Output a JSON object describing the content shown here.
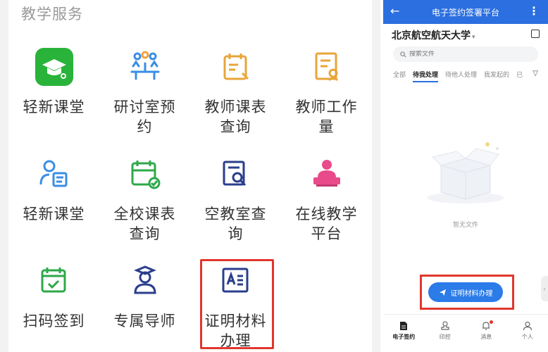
{
  "left": {
    "section_title": "教学服务",
    "tiles": [
      {
        "label": "轻新课堂",
        "icon": "graduation-cap-app-icon"
      },
      {
        "label": "研讨室预约",
        "icon": "meeting-people-icon"
      },
      {
        "label": "教师课表查询",
        "icon": "calendar-icon"
      },
      {
        "label": "教师工作量",
        "icon": "document-person-icon"
      },
      {
        "label": "轻新课堂",
        "icon": "person-card-icon"
      },
      {
        "label": "全校课表查询",
        "icon": "calendar-check-icon"
      },
      {
        "label": "空教室查询",
        "icon": "room-search-icon"
      },
      {
        "label": "在线教学平台",
        "icon": "online-teacher-icon"
      },
      {
        "label": "扫码签到",
        "icon": "calendar-checkmark-icon"
      },
      {
        "label": "专属导师",
        "icon": "mentor-icon"
      },
      {
        "label": "证明材料办理",
        "icon": "certificate-doc-icon"
      }
    ]
  },
  "phone": {
    "title": "电子签约签署平台",
    "org": "北京航空航天大学",
    "search_placeholder": "搜索文件",
    "tabs": [
      "全部",
      "待我处理",
      "待他人处理",
      "我发起的",
      "已"
    ],
    "active_tab": "待我处理",
    "empty_text": "暂无文件",
    "action_button": "证明材料办理",
    "nav": [
      {
        "label": "电子签约",
        "icon": "document-icon"
      },
      {
        "label": "印控",
        "icon": "stamp-icon"
      },
      {
        "label": "消息",
        "icon": "bell-icon"
      },
      {
        "label": "个人",
        "icon": "person-icon"
      }
    ],
    "colors": {
      "primary": "#2b6fe0",
      "highlight": "#e0372d"
    }
  }
}
